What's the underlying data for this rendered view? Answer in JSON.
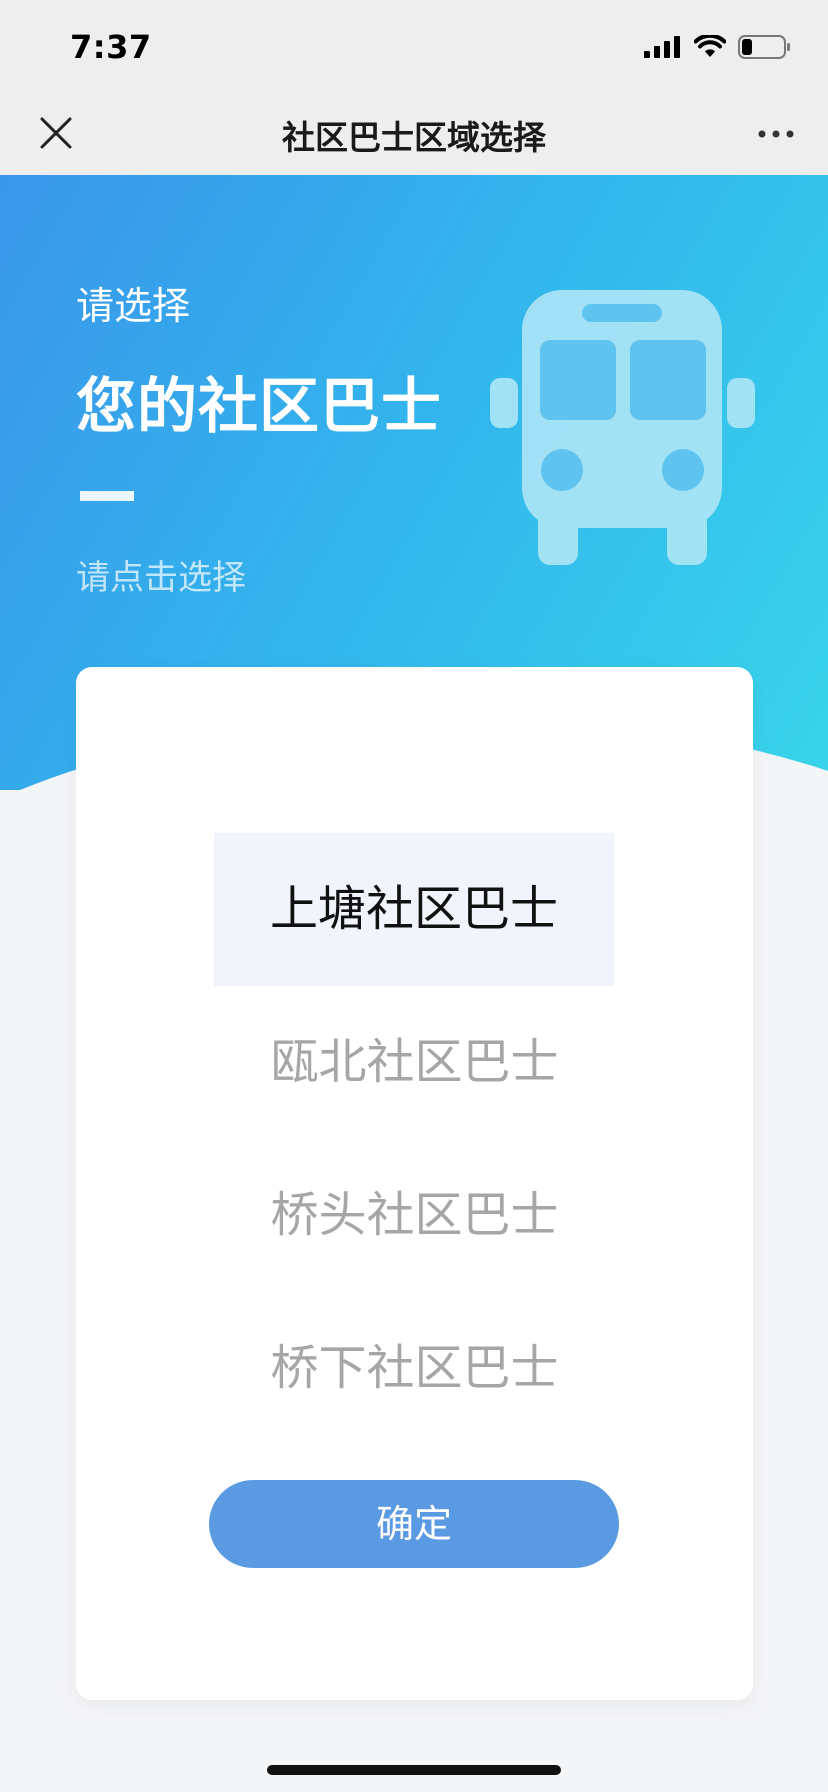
{
  "status_bar": {
    "time": "7:37"
  },
  "nav": {
    "title": "社区巴士区域选择"
  },
  "hero": {
    "small_title": "请选择",
    "big_title": "您的社区巴士",
    "hint": "请点击选择"
  },
  "options": [
    {
      "label": "上塘社区巴士",
      "selected": true
    },
    {
      "label": "瓯北社区巴士",
      "selected": false
    },
    {
      "label": "桥头社区巴士",
      "selected": false
    },
    {
      "label": "桥下社区巴士",
      "selected": false
    }
  ],
  "confirm": {
    "label": "确定"
  },
  "colors": {
    "accent": "#5a9ae2",
    "hero_start": "#3a96ea",
    "hero_end": "#38d4ea",
    "selected_bg": "#f1f5fb"
  },
  "icons": [
    "close-icon",
    "more-icon",
    "signal-icon",
    "wifi-icon",
    "battery-icon",
    "bus-icon"
  ]
}
